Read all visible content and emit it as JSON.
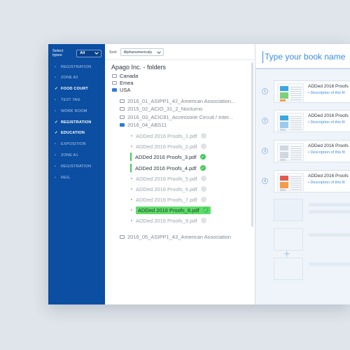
{
  "sidebar": {
    "select_label": "Select types:",
    "select_value": "All",
    "items": [
      {
        "label": "REGISTRATION",
        "mark": "•",
        "checked": false
      },
      {
        "label": "ZONE A2",
        "mark": "•",
        "checked": false
      },
      {
        "label": "FOOD COURT",
        "mark": "✓",
        "checked": true
      },
      {
        "label": "TEST TAG",
        "mark": "•",
        "checked": false
      },
      {
        "label": "WORK ROOM",
        "mark": "•",
        "checked": false
      },
      {
        "label": "REGISTRATION",
        "mark": "✓",
        "checked": true
      },
      {
        "label": "EDUCATION",
        "mark": "✓",
        "checked": true
      },
      {
        "label": "EXPOSITION",
        "mark": "•",
        "checked": false
      },
      {
        "label": "ZONE A1",
        "mark": "•",
        "checked": false
      },
      {
        "label": "REGISTRATION",
        "mark": "•",
        "checked": false
      },
      {
        "label": "REG.",
        "mark": "•",
        "checked": false
      }
    ]
  },
  "sort": {
    "label": "Sort:",
    "value": "Alphanumericaly"
  },
  "folders": {
    "title": "Apago Inc. - folders",
    "top": [
      "Canada",
      "Emea",
      "USA"
    ],
    "sub": [
      "2016_01_ASIPP1_42_American Association...",
      "2015_02_ACIO_31_2_Nocturno",
      "2016_03_ACIC81_Accessorie Circuit / Inter...",
      "2016_04_ABS11"
    ],
    "files": [
      {
        "name": "ADDed 2016 Proofs_1.pdf",
        "done": false
      },
      {
        "name": "ADDed 2016 Proofs_2.pdf",
        "done": false
      },
      {
        "name": "ADDed 2016 Proofs_3.pdf",
        "done": true
      },
      {
        "name": "ADDed 2016 Proofs_4.pdf",
        "done": true
      },
      {
        "name": "ADDed 2016 Proofs_5.pdf",
        "done": false
      },
      {
        "name": "ADDed 2016 Proofs_6.pdf",
        "done": false
      },
      {
        "name": "ADDed 2016 Proofs_7.pdf",
        "done": false
      },
      {
        "name": "ADDed 2016 Proofs_8.pdf",
        "done": true,
        "highlighted": true
      },
      {
        "name": "ADDed 2016 Proofs_9.pdf",
        "done": false
      }
    ],
    "last": "2016_05_ASIPP1_43_American Association",
    "check_glyph": "✓"
  },
  "book": {
    "title": "Type your book name",
    "cards": [
      {
        "num": "1",
        "title": "ADDed 2016 Proofs",
        "desc": "• Description of this fil"
      },
      {
        "num": "2",
        "title": "ADDed 2016 Proofs",
        "desc": "• Description of this fil"
      },
      {
        "num": "3",
        "title": "ADDed 2016 Proofs",
        "desc": "• Description of this fil"
      },
      {
        "num": "4",
        "title": "ADDed 2016 Proofs",
        "desc": "• Description of this fil"
      }
    ],
    "plus_glyph": "+"
  },
  "colors": {
    "sidebar": "#0b4ea2",
    "accent": "#3a8ee0",
    "success": "#3fcb5a",
    "highlight": "#5fdc6b"
  }
}
